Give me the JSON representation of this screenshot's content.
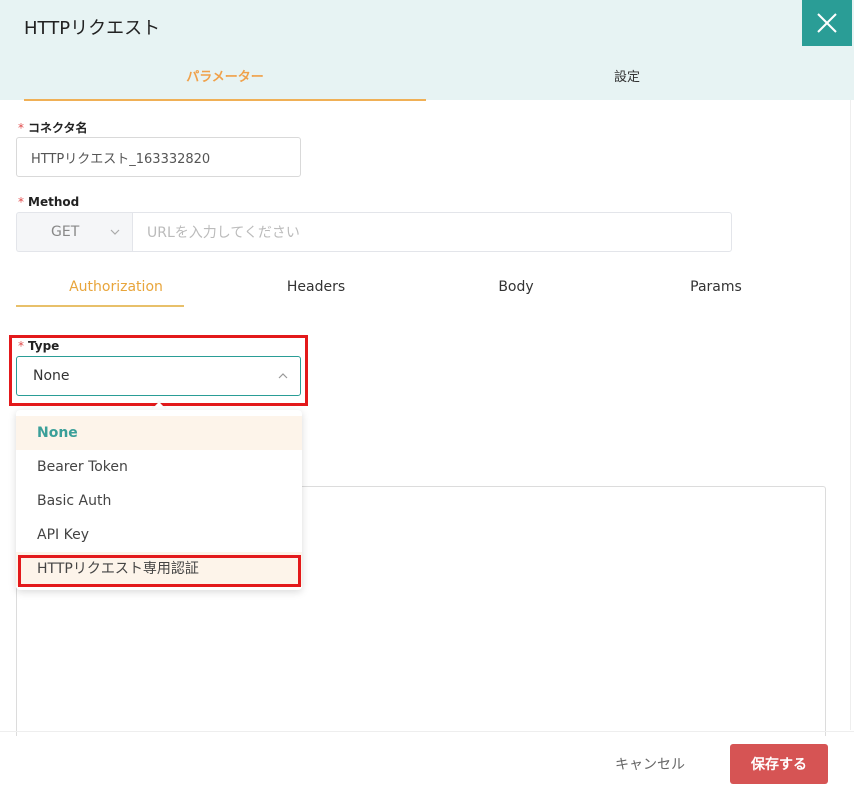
{
  "dialog": {
    "title": "HTTPリクエスト"
  },
  "main_tabs": [
    {
      "label": "パラメーター",
      "active": true
    },
    {
      "label": "設定",
      "active": false
    }
  ],
  "connector_name": {
    "label": "コネクタ名",
    "required_mark": "*",
    "value": "HTTPリクエスト_163332820"
  },
  "method": {
    "label": "Method",
    "required_mark": "*",
    "selected": "GET",
    "url_placeholder": "URLを入力してください"
  },
  "sub_tabs": [
    {
      "label": "Authorization",
      "active": true
    },
    {
      "label": "Headers",
      "active": false
    },
    {
      "label": "Body",
      "active": false
    },
    {
      "label": "Params",
      "active": false
    }
  ],
  "auth_type": {
    "label": "Type",
    "required_mark": "*",
    "selected": "None",
    "options": [
      "None",
      "Bearer Token",
      "Basic Auth",
      "API Key",
      "HTTPリクエスト専用認証"
    ]
  },
  "footer": {
    "cancel_label": "キャンセル",
    "save_label": "保存する"
  },
  "colors": {
    "accent_teal": "#2a9d96",
    "accent_orange": "#f0a14a",
    "save_red": "#d65454",
    "highlight_red": "#e3191b"
  }
}
